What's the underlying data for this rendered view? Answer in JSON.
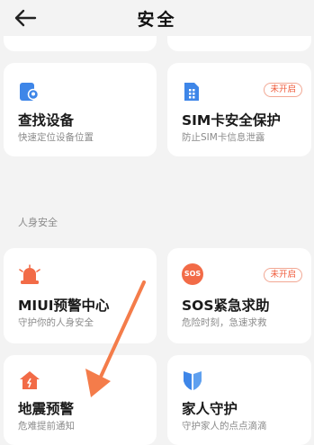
{
  "header": {
    "title": "安全"
  },
  "cards_row1": [
    {
      "title": "查找设备",
      "subtitle": "快速定位设备位置",
      "icon": "location-phone-icon"
    },
    {
      "title": "SIM卡安全保护",
      "subtitle": "防止SIM卡信息泄露",
      "icon": "sim-card-icon",
      "badge": "未开启"
    }
  ],
  "section": {
    "label": "人身安全"
  },
  "cards_row2": [
    {
      "title": "MIUI预警中心",
      "subtitle": "守护你的人身安全",
      "icon": "alarm-siren-icon"
    },
    {
      "title": "SOS紧急求助",
      "subtitle": "危险时刻，急速求救",
      "icon": "sos-icon",
      "badge": "未开启",
      "icon_text": "SOS"
    }
  ],
  "cards_row3": [
    {
      "title": "地震预警",
      "subtitle": "危难提前通知",
      "icon": "earthquake-house-icon"
    },
    {
      "title": "家人守护",
      "subtitle": "守护家人的点点滴滴",
      "icon": "family-shield-icon"
    }
  ],
  "colors": {
    "accent_blue": "#3e86e8",
    "accent_orange": "#f26b47",
    "badge_red": "#ef5a3a",
    "annotation_arrow": "#f47c4a"
  }
}
